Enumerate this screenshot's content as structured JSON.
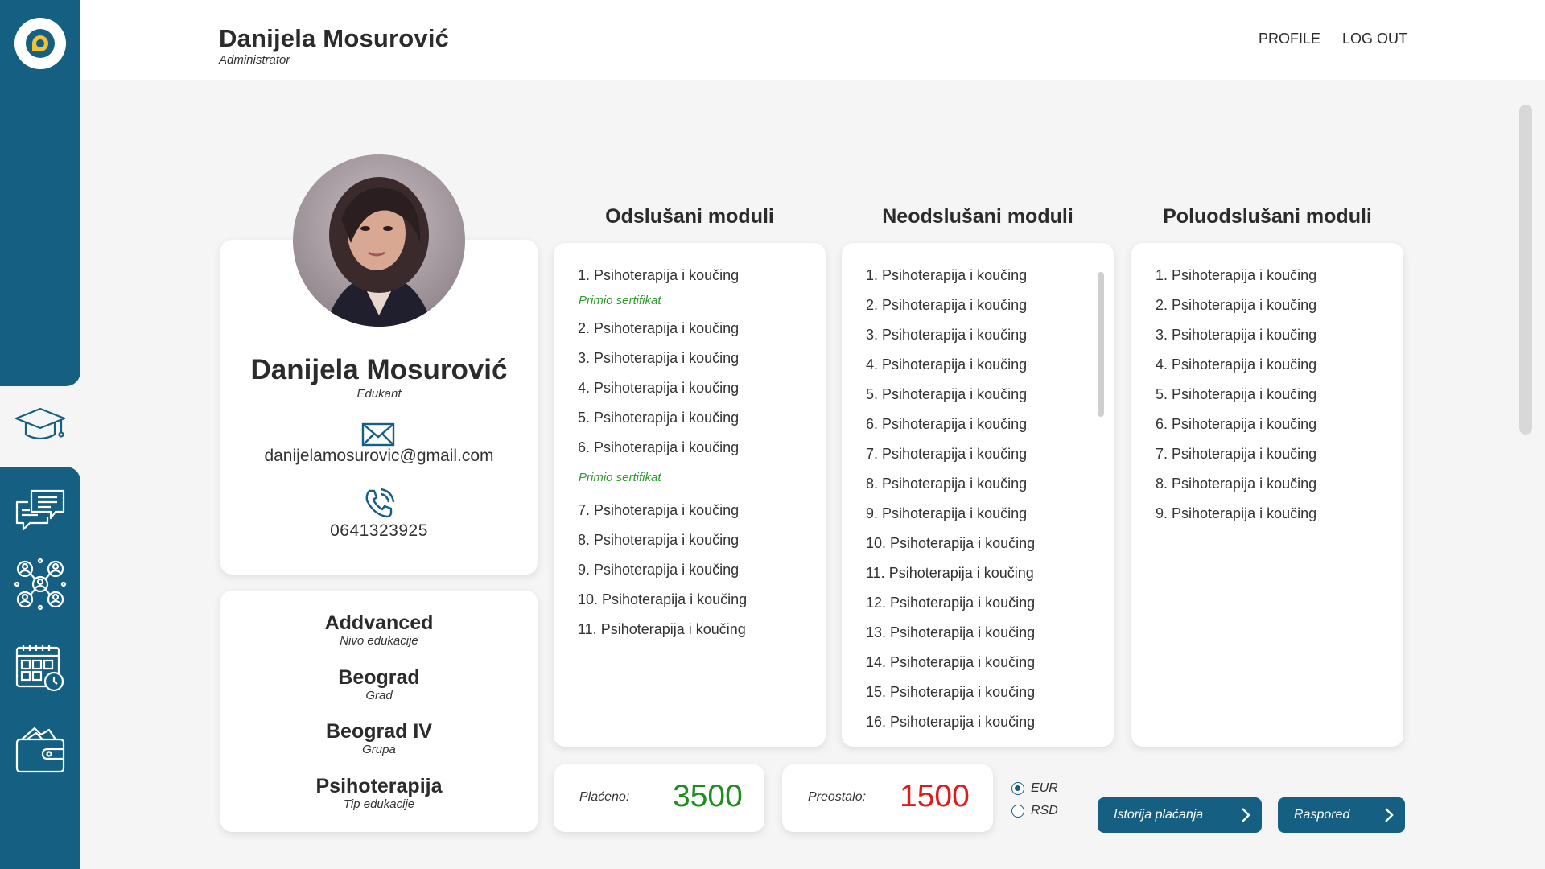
{
  "header": {
    "name": "Danijela Mosurović",
    "role": "Administrator",
    "nav": {
      "profile": "PROFILE",
      "logout": "LOG OUT"
    }
  },
  "sidebar": {
    "icons": [
      "logo-icon",
      "education-icon",
      "chat-icon",
      "network-icon",
      "calendar-icon",
      "wallet-icon"
    ]
  },
  "profile": {
    "name": "Danijela Mosurović",
    "role": "Edukant",
    "email": "danijelamosurovic@gmail.com",
    "phone": "0641323925"
  },
  "info": [
    {
      "value": "Addvanced",
      "label": "Nivo edukacije"
    },
    {
      "value": "Beograd",
      "label": "Grad"
    },
    {
      "value": "Beograd IV",
      "label": "Grupa"
    },
    {
      "value": "Psihoterapija",
      "label": "Tip edukacije"
    }
  ],
  "modules": {
    "completed": {
      "title": "Odslušani moduli",
      "items": [
        "1. Psihoterapija i koučing",
        "Primio sertifikat",
        "2. Psihoterapija i koučing",
        "3. Psihoterapija i koučing",
        "4. Psihoterapija i koučing",
        "5. Psihoterapija i koučing",
        "6. Psihoterapija i koučing",
        "Primio sertifikat",
        "7. Psihoterapija i koučing",
        "8. Psihoterapija i koučing",
        "9. Psihoterapija i koučing",
        "10. Psihoterapija i koučing",
        "11. Psihoterapija i koučing"
      ]
    },
    "not_completed": {
      "title": "Neodslušani moduli",
      "items": [
        "1. Psihoterapija i koučing",
        "2. Psihoterapija i koučing",
        "3. Psihoterapija i koučing",
        "4. Psihoterapija i koučing",
        "5. Psihoterapija i koučing",
        "6. Psihoterapija i koučing",
        "7. Psihoterapija i koučing",
        "8. Psihoterapija i koučing",
        "9. Psihoterapija i koučing",
        "10. Psihoterapija i koučing",
        "11. Psihoterapija i koučing",
        "12. Psihoterapija i koučing",
        "13. Psihoterapija i koučing",
        "14. Psihoterapija i koučing",
        "15. Psihoterapija i koučing",
        "16. Psihoterapija i koučing"
      ]
    },
    "partial": {
      "title": "Poluodslušani moduli",
      "items": [
        "1. Psihoterapija i koučing",
        "2. Psihoterapija i koučing",
        "3. Psihoterapija i koučing",
        "4. Psihoterapija i koučing",
        "5. Psihoterapija i koučing",
        "6. Psihoterapija i koučing",
        "7. Psihoterapija i koučing",
        "8. Psihoterapija i koučing",
        "9. Psihoterapija i koučing"
      ]
    }
  },
  "payment": {
    "paid_label": "Plaćeno:",
    "paid_value": "3500",
    "remaining_label": "Preostalo:",
    "remaining_value": "1500",
    "currency": {
      "options": [
        "EUR",
        "RSD"
      ],
      "selected": "EUR"
    },
    "history_button": "Istorija plaćanja",
    "schedule_button": "Raspored"
  },
  "colors": {
    "primary": "#156082",
    "paid": "#1e8f1e",
    "remaining": "#e01b1b",
    "certificate": "#2e9b2e"
  }
}
